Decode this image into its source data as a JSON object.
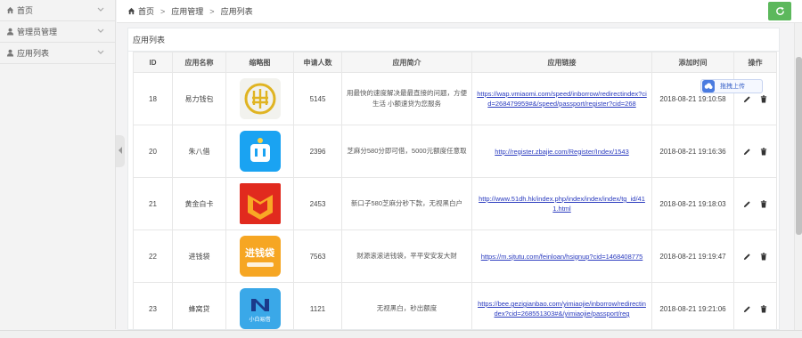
{
  "sidebar": {
    "items": [
      {
        "label": "首页",
        "icon": "home-icon"
      },
      {
        "label": "管理员管理",
        "icon": "user-icon"
      },
      {
        "label": "应用列表",
        "icon": "user-icon"
      }
    ]
  },
  "breadcrumb": {
    "home": "首页",
    "sep1": ">",
    "level2": "应用管理",
    "sep2": ">",
    "level3": "应用列表"
  },
  "panel": {
    "title": "应用列表"
  },
  "drag_upload": {
    "label": "拖拽上传"
  },
  "table": {
    "headers": [
      "ID",
      "应用名称",
      "缩略图",
      "申请人数",
      "应用简介",
      "应用链接",
      "添加时间",
      "操作"
    ],
    "rows": [
      {
        "id": "18",
        "name": "易力钱包",
        "applicants": "5145",
        "desc": "用最快的速度解决最最直接的问题，方便生活 小额速贷为您服务",
        "link": "https://wap.vmiaomi.com/speed/inborrow/redirectindex?cid=268479959#&/speed/passport/register?cid=268",
        "time": "2018-08-21 19:10:58",
        "logo": "yili"
      },
      {
        "id": "20",
        "name": "朱八借",
        "applicants": "2396",
        "desc": "芝麻分580分即可借，5000元额度任意取",
        "link": "http://register.zbajie.com/Register/Index/1543",
        "time": "2018-08-21 19:16:36",
        "logo": "zhubajie"
      },
      {
        "id": "21",
        "name": "黄金白卡",
        "applicants": "2453",
        "desc": "新口子580芝麻分秒下款，无视黑白户",
        "link": "http://www.51dh.hk/index.php/index/index/index/tg_id/411.html",
        "time": "2018-08-21 19:18:03",
        "logo": "huangjin"
      },
      {
        "id": "22",
        "name": "进钱袋",
        "applicants": "7563",
        "desc": "财源滚滚进钱袋，平平安安发大财",
        "link": "https://m.sjtutu.com/feinloan/hsignup?cid=1468408775",
        "time": "2018-08-21 19:19:47",
        "logo": "jinqiandai"
      },
      {
        "id": "23",
        "name": "蜂窝贷",
        "applicants": "1121",
        "desc": "无视黑白，秒出额度",
        "link": "https://bee.gezigianbao.com/yimiaojie/inborrow/redirectindex?cid=268551303#&/yimiaojie/passport/reg",
        "time": "2018-08-21 19:21:06",
        "logo": "fengwo"
      }
    ]
  },
  "logos": {
    "jinqiandai_text": "进钱袋",
    "fengwo_text": "小白易借"
  },
  "colors": {
    "accent_green": "#5cb85c",
    "link_blue": "#2a3bbf",
    "yili_bg": "#f2f2ee",
    "zhubajie_bg": "#1aa3f2",
    "huangjin_bg": "#e12a1e",
    "jinqiandai_bg": "#f6a623",
    "fengwo_bg": "#3aa8e8"
  }
}
